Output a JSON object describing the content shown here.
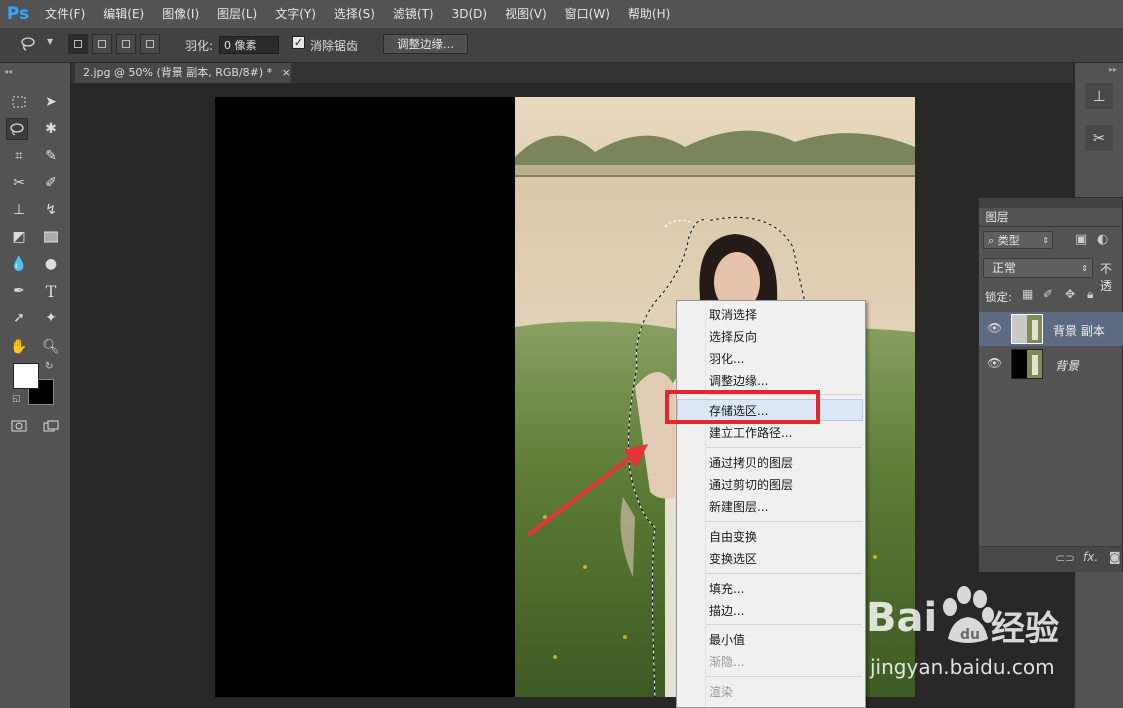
{
  "app": {
    "logo": "Ps"
  },
  "menu": [
    "文件(F)",
    "编辑(E)",
    "图像(I)",
    "图层(L)",
    "文字(Y)",
    "选择(S)",
    "滤镜(T)",
    "3D(D)",
    "视图(V)",
    "窗口(W)",
    "帮助(H)"
  ],
  "options": {
    "feather_label": "羽化:",
    "feather_value": "0 像素",
    "antialias_label": "消除锯齿",
    "antialias_checked": true,
    "refine_edge_label": "调整边缘..."
  },
  "document": {
    "tab_title": "2.jpg @ 50% (背景 副本, RGB/8#) *",
    "close": "×"
  },
  "layers": {
    "tab": "图层",
    "filter_kind": "类型",
    "blend_mode": "正常",
    "opacity_label": "不透",
    "lock_label": "锁定:",
    "items": [
      {
        "name": "背景 副本",
        "selected": true
      },
      {
        "name": "背景",
        "selected": false
      }
    ]
  },
  "context_menu": {
    "groups": [
      [
        "取消选择",
        "选择反向",
        "羽化...",
        "调整边缘..."
      ],
      [
        "存储选区...",
        "建立工作路径..."
      ],
      [
        "通过拷贝的图层",
        "通过剪切的图层",
        "新建图层..."
      ],
      [
        "自由变换",
        "变换选区"
      ],
      [
        "填充...",
        "描边..."
      ],
      [
        "最小值",
        "渐隐..."
      ],
      [
        "渲染"
      ]
    ],
    "disabled": [
      "渐隐...",
      "渲染"
    ],
    "hovered": "存储选区..."
  },
  "watermark": {
    "text": "Bai",
    "text2": "经验",
    "url": "jingyan.baidu.com"
  },
  "colors": {
    "highlight": "#e8262a",
    "arrow": "#e8323a"
  }
}
